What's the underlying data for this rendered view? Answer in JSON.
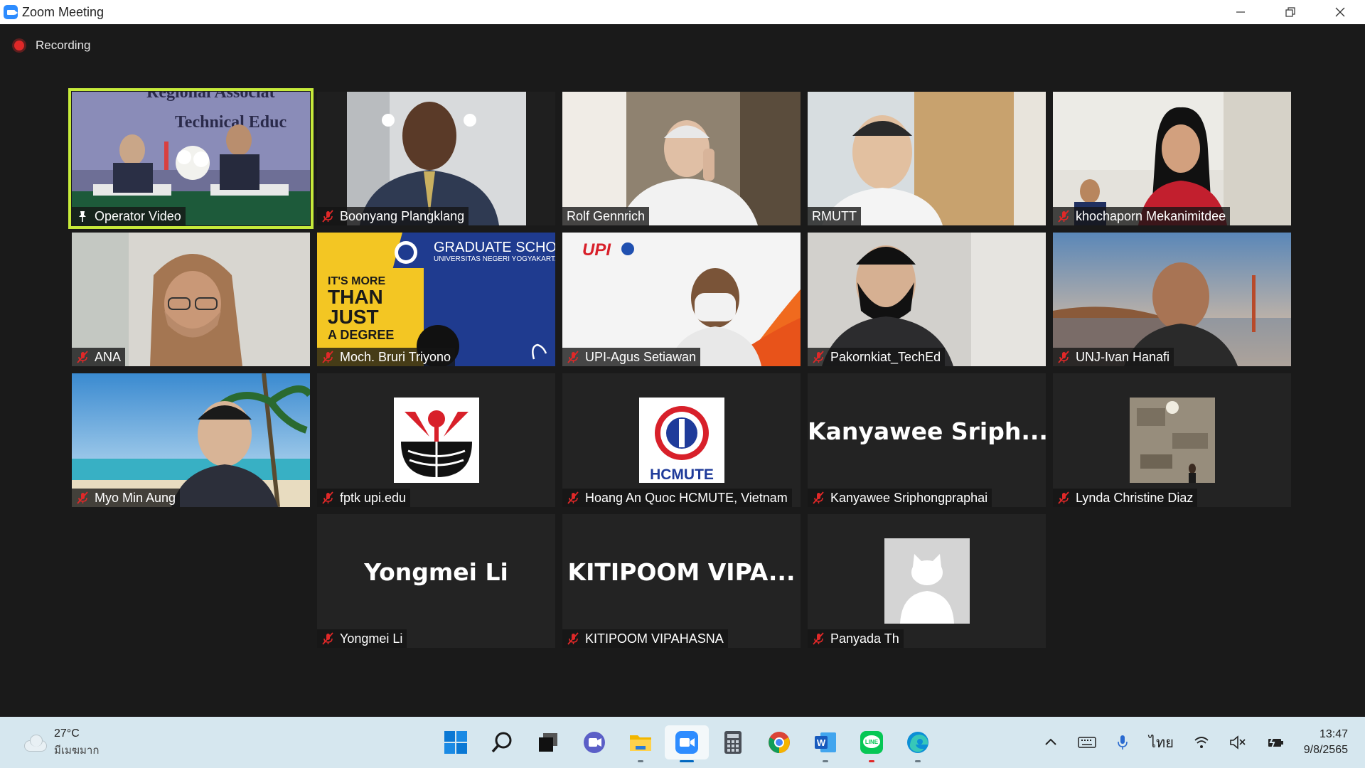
{
  "window": {
    "title": "Zoom Meeting",
    "minimize": "—",
    "restore": "❐",
    "close": "✕"
  },
  "recording": {
    "label": "Recording"
  },
  "participants": [
    {
      "name": "Operator Video",
      "pinned": true,
      "muted": false
    },
    {
      "name": "Boonyang Plangklang",
      "muted": true
    },
    {
      "name": "Rolf Gennrich",
      "muted": false
    },
    {
      "name": "RMUTT",
      "muted": false
    },
    {
      "name": "khochaporn Mekanimitdee",
      "muted": true
    },
    {
      "name": "ANA",
      "muted": true
    },
    {
      "name": "Moch. Bruri Triyono",
      "muted": true
    },
    {
      "name": "UPI-Agus Setiawan",
      "muted": true
    },
    {
      "name": "Pakornkiat_TechEd",
      "muted": true
    },
    {
      "name": "UNJ-Ivan Hanafi",
      "muted": true
    },
    {
      "name": "Myo Min Aung",
      "muted": true
    },
    {
      "name": "fptk upi.edu",
      "muted": true
    },
    {
      "name": "Hoang An Quoc HCMUTE, Vietnam",
      "muted": true
    },
    {
      "name": "Kanyawee Sriphongpraphai",
      "muted": true,
      "display_name": "Kanyawee  Sriph..."
    },
    {
      "name": "Lynda Christine Diaz",
      "muted": true
    },
    {
      "name": "Yongmei Li",
      "muted": true,
      "display_name": "Yongmei Li"
    },
    {
      "name": "KITIPOOM VIPAHASNA",
      "muted": true,
      "display_name": "KITIPOOM  VIPA..."
    },
    {
      "name": "Panyada Th",
      "muted": true
    }
  ],
  "tile_text": {
    "banner_top": "Regional Associat",
    "banner_mid": "Technical Educ",
    "grad_school": "GRADUATE SCHOOL",
    "grad_univ": "UNIVERSITAS NEGERI YOGYAKARTA",
    "its_more": "IT'S MORE",
    "than": "THAN",
    "just": "JUST",
    "a_degree": "A DEGREE",
    "upi": "UPI",
    "hcmute": "HCMUTE"
  },
  "taskbar": {
    "weather_temp": "27°C",
    "weather_desc": "มีเมฆมาก",
    "language": "ไทย",
    "time": "13:47",
    "date": "9/8/2565",
    "apps": [
      "start",
      "search",
      "task-view",
      "teams-chat",
      "file-explorer",
      "zoom",
      "calculator",
      "chrome",
      "word",
      "line",
      "edge"
    ]
  },
  "colors": {
    "active_speaker": "#c6ea3a",
    "recording": "#e02828",
    "mute": "#e02828"
  }
}
